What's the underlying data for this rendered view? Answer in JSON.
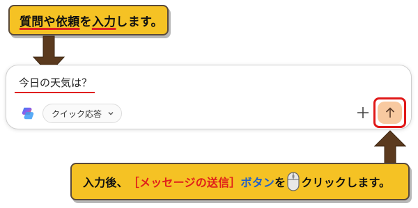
{
  "callout_top": {
    "part1": "質問や依頼",
    "part2": "を",
    "part3": "入力",
    "part4": "します。"
  },
  "input": {
    "value": "今日の天気は？"
  },
  "mode": {
    "label": "クイック応答"
  },
  "icons": {
    "copilot": "copilot-logo-icon",
    "chevron": "chevron-down-icon",
    "plus": "plus-icon",
    "send": "arrow-up-icon",
    "mouse": "mouse-icon"
  },
  "callout_bottom": {
    "part1": "入力後、",
    "part2": "［メッセージの送信］",
    "part3": "ボタン",
    "part4": "を",
    "part5": "クリックします。"
  },
  "colors": {
    "callout": "#f5c224",
    "arrow": "#5b3a1e",
    "highlight": "#e02020",
    "send_button": "#f8c9a0",
    "blue_text": "#1f5fc8"
  }
}
